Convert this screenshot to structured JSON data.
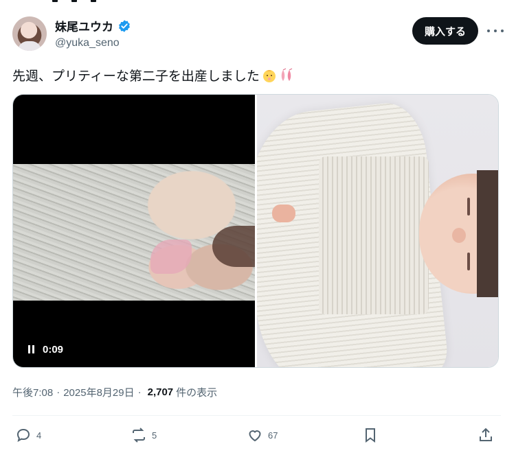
{
  "author": {
    "display_name": "妹尾ユウカ",
    "handle": "@yuka_seno",
    "verified": true
  },
  "header": {
    "buy_label": "購入する",
    "more_icon": "more-horizontal-icon"
  },
  "tweet": {
    "text": "先週、プリティーな第二子を出産しました"
  },
  "media": {
    "video_time": "0:09"
  },
  "meta": {
    "time": "午後7:08",
    "date": "2025年8月29日",
    "views_count": "2,707",
    "views_suffix": "件の表示"
  },
  "actions": {
    "replies": "4",
    "reposts": "5",
    "likes": "67"
  },
  "colors": {
    "text": "#0f1419",
    "secondary": "#536471",
    "verified": "#1d9bf0",
    "button_bg": "#0f1419"
  }
}
